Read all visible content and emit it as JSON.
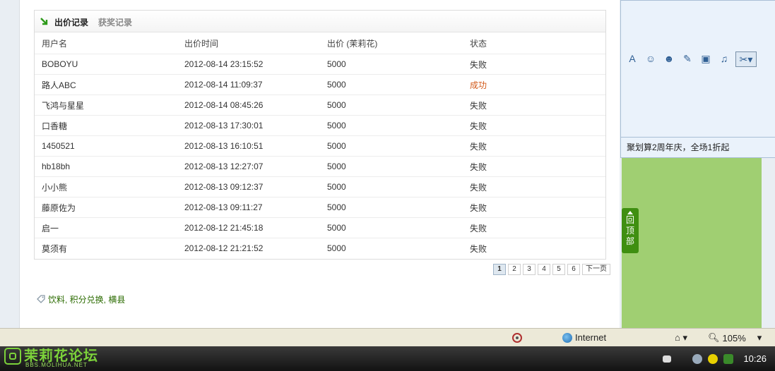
{
  "tabs": {
    "bid_records": "出价记录",
    "award_records": "获奖记录"
  },
  "table": {
    "headers": [
      "用户名",
      "出价时间",
      "出价 (茉莉花)",
      "状态"
    ],
    "rows": [
      [
        "BOBOYU",
        "2012-08-14 23:15:52",
        "5000",
        "失败"
      ],
      [
        "路人ABC",
        "2012-08-14 11:09:37",
        "5000",
        "成功"
      ],
      [
        "飞鸿与星星",
        "2012-08-14 08:45:26",
        "5000",
        "失败"
      ],
      [
        "口香糖",
        "2012-08-13 17:30:01",
        "5000",
        "失败"
      ],
      [
        "1450521",
        "2012-08-13 16:10:51",
        "5000",
        "失败"
      ],
      [
        "hb18bh",
        "2012-08-13 12:27:07",
        "5000",
        "失败"
      ],
      [
        "小小熊",
        "2012-08-13 09:12:37",
        "5000",
        "失败"
      ],
      [
        "藤原佐为",
        "2012-08-13 09:11:27",
        "5000",
        "失败"
      ],
      [
        "启一",
        "2012-08-12 21:45:18",
        "5000",
        "失败"
      ],
      [
        "莫须有",
        "2012-08-12 21:21:52",
        "5000",
        "失败"
      ]
    ]
  },
  "pager": {
    "pages": [
      "1",
      "2",
      "3",
      "4",
      "5",
      "6"
    ],
    "current": "1",
    "next_label": "下一页"
  },
  "tags": {
    "text": "饮料, 积分兑换, 横县"
  },
  "sidebar": {
    "toolbar_icons": [
      "font-icon",
      "smiley-icon",
      "face-icon",
      "edit-icon",
      "image-icon",
      "music-icon",
      "scissors-icon"
    ],
    "promo_text": "聚划算2周年庆，全场1折起",
    "back_to_top": "回顶部"
  },
  "statusbar": {
    "zone": "Internet",
    "zoom": "105%"
  },
  "taskbar": {
    "logo_text": "茉莉花论坛",
    "logo_sub": "BBS.MOLIHUA.NET",
    "clock": "10:26"
  }
}
